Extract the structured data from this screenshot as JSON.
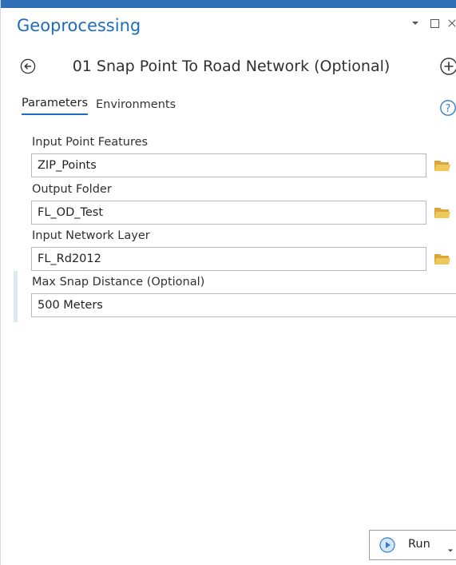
{
  "pane": {
    "title": "Geoprocessing"
  },
  "tool": {
    "title": "01 Snap Point To Road Network (Optional)"
  },
  "tabs": [
    {
      "label": "Parameters",
      "active": true
    },
    {
      "label": "Environments",
      "active": false
    }
  ],
  "parameters": [
    {
      "label": "Input Point Features",
      "value": "ZIP_Points",
      "has_browse": true
    },
    {
      "label": "Output Folder",
      "value": "FL_OD_Test",
      "has_browse": true
    },
    {
      "label": "Input Network Layer",
      "value": "FL_Rd2012",
      "has_browse": true
    },
    {
      "label": "Max Snap Distance (Optional)",
      "value": "500 Meters",
      "has_browse": false
    }
  ],
  "run_button": {
    "label": "Run"
  },
  "colors": {
    "accent": "#1d6cbf",
    "title_bar": "#2f6fb8",
    "folder": "#e9bd4c"
  },
  "icons": {
    "back": "back-arrow-icon",
    "add": "plus-circle-icon",
    "help": "help-icon",
    "browse": "folder-icon",
    "run": "play-icon",
    "pin": "chevron-down-icon",
    "maximize": "maximize-icon",
    "close": "close-icon"
  }
}
